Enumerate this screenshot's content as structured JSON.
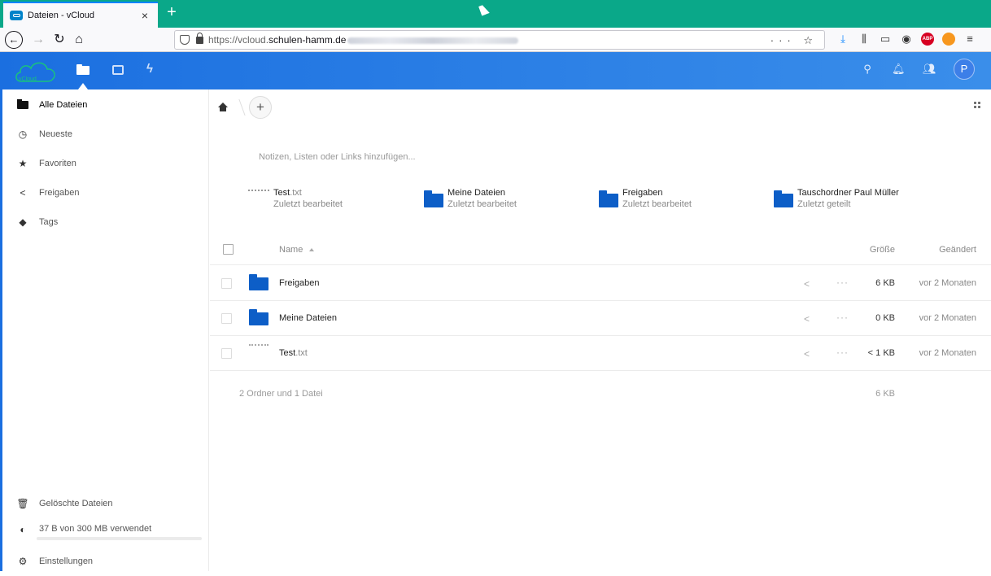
{
  "browser": {
    "tab_title": "Dateien - vCloud",
    "tab_close": "×",
    "new_tab": "+",
    "url_prefix": "https://vcloud.",
    "url_domain": "schulen-hamm.de",
    "url_actions": "··· ☆"
  },
  "header": {
    "logo_text": "vCloud",
    "avatar_initial": "P"
  },
  "sidebar": {
    "items": [
      {
        "label": "Alle Dateien"
      },
      {
        "label": "Neueste"
      },
      {
        "label": "Favoriten"
      },
      {
        "label": "Freigaben"
      },
      {
        "label": "Tags"
      }
    ],
    "deleted": "Gelöschte Dateien",
    "quota": "37 B von 300 MB verwendet",
    "quota_fraction": 0.0,
    "settings": "Einstellungen"
  },
  "main": {
    "add_label": "+",
    "notes_placeholder": "Notizen, Listen oder Links hinzufügen...",
    "recent": [
      {
        "name": "Test",
        "ext": ".txt",
        "sub": "Zuletzt bearbeitet",
        "type": "file"
      },
      {
        "name": "Meine Dateien",
        "ext": "",
        "sub": "Zuletzt bearbeitet",
        "type": "folder"
      },
      {
        "name": "Freigaben",
        "ext": "",
        "sub": "Zuletzt bearbeitet",
        "type": "folder"
      },
      {
        "name": "Tauschordner Paul Müller",
        "ext": "",
        "sub": "Zuletzt geteilt",
        "type": "folder"
      }
    ],
    "columns": {
      "name": "Name",
      "size": "Größe",
      "modified": "Geändert"
    },
    "rows": [
      {
        "name": "Freigaben",
        "ext": "",
        "size": "6 KB",
        "modified": "vor 2 Monaten",
        "type": "folder"
      },
      {
        "name": "Meine Dateien",
        "ext": "",
        "size": "0 KB",
        "modified": "vor 2 Monaten",
        "type": "folder"
      },
      {
        "name": "Test",
        "ext": ".txt",
        "size": "< 1 KB",
        "modified": "vor 2 Monaten",
        "type": "file"
      }
    ],
    "summary": "2 Ordner und 1 Datei",
    "summary_size": "6 KB"
  },
  "colors": {
    "header_blue": "#1b6fe0",
    "folder_blue": "#0d5ec7",
    "tabbar_green": "#0aa889"
  }
}
